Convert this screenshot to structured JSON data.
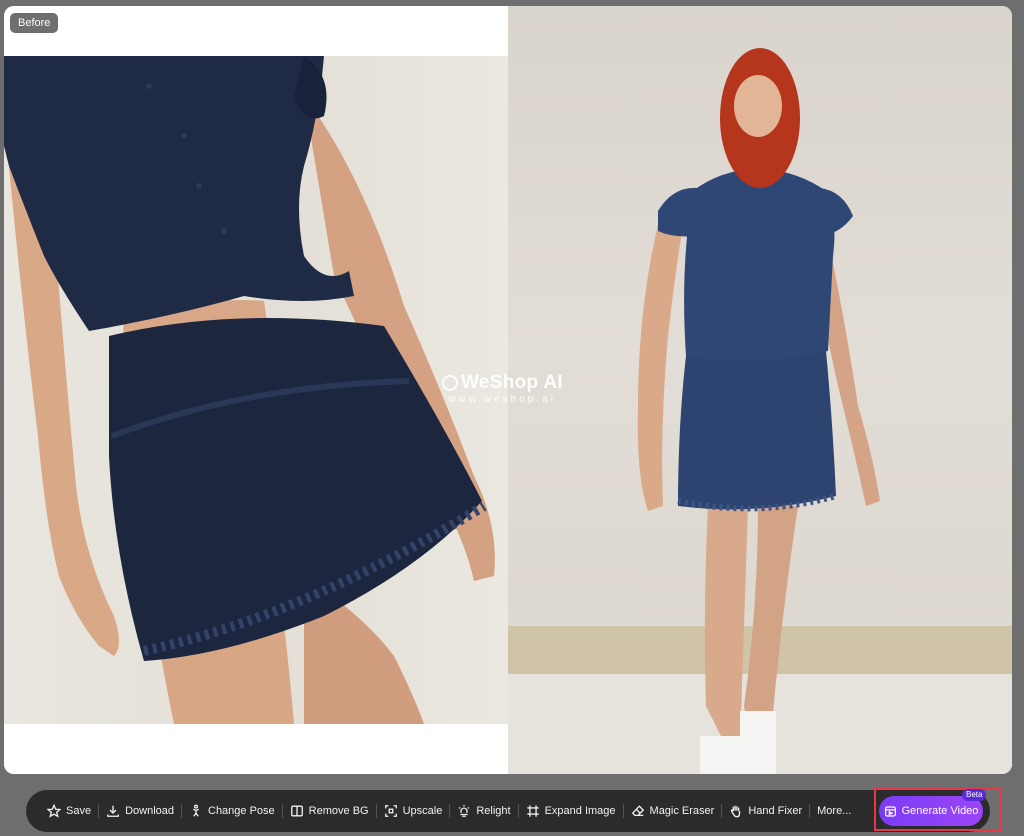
{
  "compare": {
    "before_label": "Before"
  },
  "watermark": {
    "title": "WeShop AI",
    "url": "www.weshop.ai"
  },
  "toolbar": {
    "items": [
      {
        "label": "Save",
        "icon": "star-icon"
      },
      {
        "label": "Download",
        "icon": "download-icon"
      },
      {
        "label": "Change Pose",
        "icon": "pose-icon"
      },
      {
        "label": "Remove BG",
        "icon": "remove-bg-icon"
      },
      {
        "label": "Upscale",
        "icon": "upscale-icon"
      },
      {
        "label": "Relight",
        "icon": "relight-icon"
      },
      {
        "label": "Expand Image",
        "icon": "expand-icon"
      },
      {
        "label": "Magic Eraser",
        "icon": "eraser-icon"
      },
      {
        "label": "Hand Fixer",
        "icon": "hand-icon"
      },
      {
        "label": "More...",
        "icon": ""
      }
    ],
    "generate_video": {
      "label": "Generate Video",
      "badge": "Beta",
      "icon": "video-icon"
    }
  },
  "colors": {
    "toolbar_bg": "#2b2b2b",
    "accent": "#8b41f6",
    "highlight_border": "#e53949",
    "garment": "#1f2a44"
  }
}
